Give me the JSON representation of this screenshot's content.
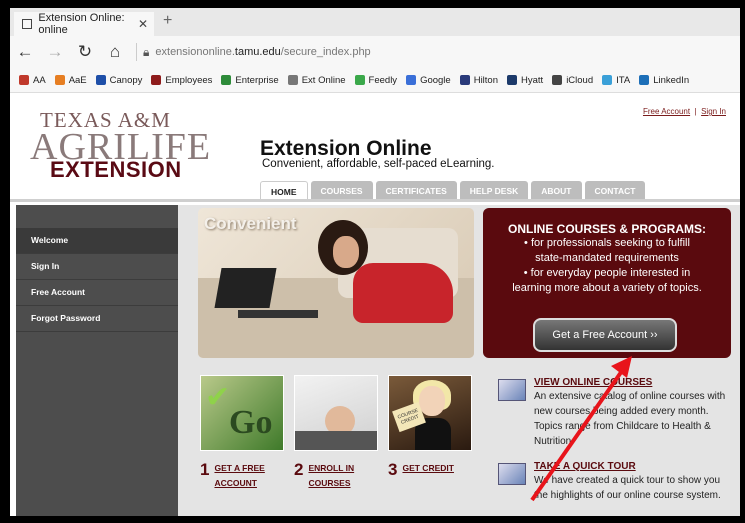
{
  "browser": {
    "tab_title": "Extension Online: online",
    "tab_close": "✕",
    "new_tab": "+",
    "url_prefix": "extensiononline.",
    "url_domain": "tamu.edu",
    "url_path": "/secure_index.php",
    "favorites": [
      {
        "label": "AA",
        "color": "#c0392b"
      },
      {
        "label": "AaE",
        "color": "#e67e22"
      },
      {
        "label": "Canopy",
        "color": "#1e4fa8"
      },
      {
        "label": "Employees",
        "color": "#8e1b1b"
      },
      {
        "label": "Enterprise",
        "color": "#2e8b3a"
      },
      {
        "label": "Ext Online",
        "color": "#777777"
      },
      {
        "label": "Feedly",
        "color": "#3aa84a"
      },
      {
        "label": "Google",
        "color": "#3a6fd8"
      },
      {
        "label": "Hilton",
        "color": "#2a3a7a"
      },
      {
        "label": "Hyatt",
        "color": "#1c3a6a"
      },
      {
        "label": "iCloud",
        "color": "#444444"
      },
      {
        "label": "ITA",
        "color": "#3aa0d8"
      },
      {
        "label": "LinkedIn",
        "color": "#1d6fb8"
      }
    ]
  },
  "site": {
    "toplinks": {
      "free_account": "Free Account",
      "sep": "|",
      "sign_in": "Sign In"
    },
    "logo": {
      "line1": "TEXAS A&M",
      "line2": "AGRILIFE",
      "line3": "EXTENSION"
    },
    "title": "Extension Online",
    "subtitle": "Convenient, affordable, self-paced eLearning.",
    "tabs": [
      "HOME",
      "COURSES",
      "CERTIFICATES",
      "HELP DESK",
      "ABOUT",
      "CONTACT"
    ],
    "sidebar": [
      "Welcome",
      "Sign In",
      "Free Account",
      "Forgot Password"
    ],
    "hero_word": "Convenient",
    "promo": {
      "title": "ONLINE COURSES & PROGRAMS:",
      "lines": [
        "• for professionals seeking to fulfill",
        "state-mandated requirements",
        "• for everyday people interested in",
        "learning more about a variety of topics."
      ],
      "button": "Get a Free Account ››"
    },
    "thumb3_sign": "COURSE CREDIT",
    "thumb1_text": "Go",
    "steps": [
      {
        "num": "1",
        "label": "GET A FREE ACCOUNT"
      },
      {
        "num": "2",
        "label": "ENROLL IN COURSES"
      },
      {
        "num": "3",
        "label": "GET CREDIT"
      }
    ],
    "info": [
      {
        "title": "VIEW ONLINE COURSES",
        "text": "An extensive catalog of online courses with new courses being added every month. Topics range from Childcare to Health & Nutrition."
      },
      {
        "title": "TAKE A QUICK TOUR",
        "text": "We have created a quick tour to show you the highlights of our online course system."
      }
    ]
  },
  "annotation": {
    "arrow_color": "#e8141b"
  }
}
